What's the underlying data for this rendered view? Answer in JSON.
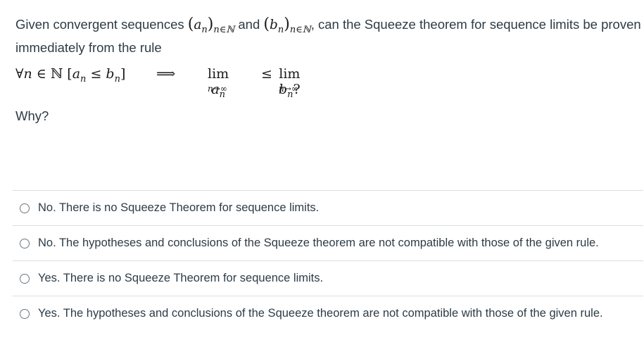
{
  "question": {
    "intro": "Given convergent sequences ",
    "seq_a_var": "a",
    "seq_a_sub": "n",
    "seq_a_index": "n∈ℕ",
    "and": " and ",
    "seq_b_var": "b",
    "seq_b_sub": "n",
    "seq_b_index": "n∈ℕ",
    "rest": ", can the Squeeze theorem for sequence limits be proven immediately from the rule",
    "rule": {
      "forall": "∀",
      "n": "n",
      "in_N": " ∈ ℕ ",
      "bracket_open": "[",
      "a": "a",
      "a_sub": "n",
      "leq": " ≤ ",
      "b": "b",
      "b_sub": "n",
      "bracket_close": "]",
      "implies": "⟹",
      "lim1": "lim",
      "lim1_under": "n→∞",
      "lim1_var": "a",
      "lim1_sub": "n",
      "leq2": "≤",
      "lim2": "lim",
      "lim2_under": "n→∞",
      "lim2_var": "b",
      "lim2_sub": "n",
      "qmark": "?"
    },
    "why": "Why?"
  },
  "answers": [
    {
      "label": "No. There is no Squeeze Theorem for sequence limits."
    },
    {
      "label": "No. The hypotheses and conclusions of the Squeeze theorem are not compatible with those of the given rule."
    },
    {
      "label": "Yes. There is no Squeeze Theorem for sequence limits."
    },
    {
      "label": "Yes. The hypotheses and conclusions of the Squeeze theorem are not compatible with those of the given rule."
    }
  ]
}
